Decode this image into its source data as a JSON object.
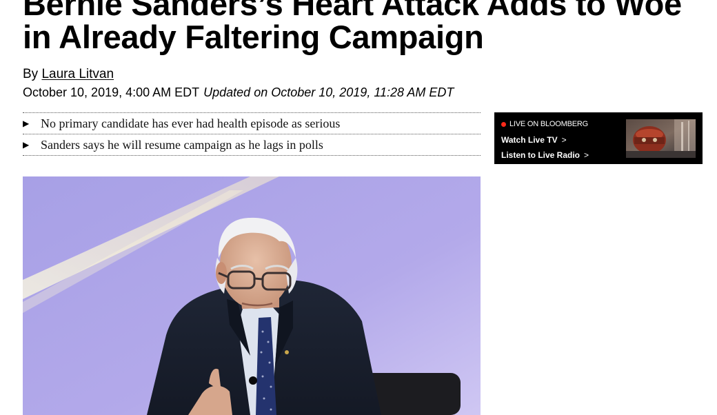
{
  "article": {
    "headline_line1": "Bernie Sanders’s Heart Attack Adds to Woe",
    "headline_line2": "in Already Faltering Campaign",
    "byline_prefix": "By ",
    "author": "Laura Litvan",
    "published": "October 10, 2019, 4:00 AM EDT",
    "updated": "Updated on October 10, 2019, 11:28 AM EDT",
    "bullets": [
      "No primary candidate has ever had health episode as serious",
      "Sanders says he will resume campaign as he lags in polls"
    ]
  },
  "live_box": {
    "label": "LIVE ON BLOOMBERG",
    "watch_label": "Watch Live TV",
    "listen_label": "Listen to Live Radio",
    "chevron": ">",
    "live_dot_color": "#ff2a1a"
  },
  "icons": {
    "bullet_arrow": "▶",
    "live_dot": "live-dot-icon"
  },
  "colors": {
    "live_box_background": "#000000",
    "hero_background": "#a99fe0"
  }
}
